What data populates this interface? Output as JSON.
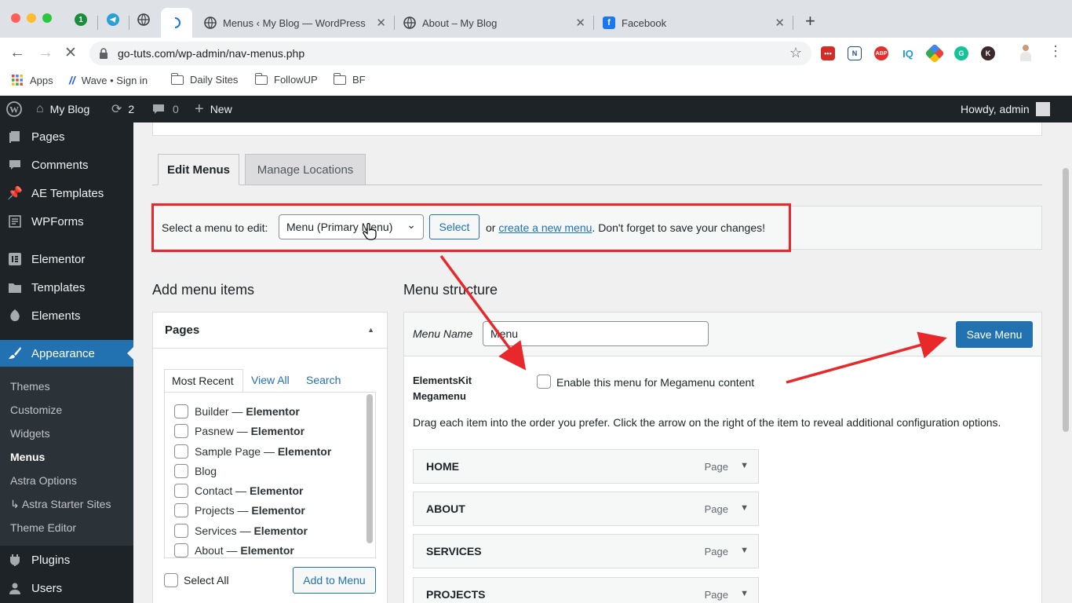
{
  "browser": {
    "pinned_tabs": [
      {
        "icon": "1password-icon",
        "badge": "1"
      },
      {
        "icon": "telegram-icon"
      },
      {
        "icon": "globe-icon"
      }
    ],
    "tabs": [
      {
        "title": "Menus ‹ My Blog — WordPress",
        "icon": "globe-icon"
      },
      {
        "title": "About – My Blog",
        "icon": "globe-icon"
      },
      {
        "title": "Facebook",
        "icon": "facebook-icon",
        "letter": "f"
      }
    ],
    "url": "go-tuts.com/wp-admin/nav-menus.php",
    "extensions": [
      {
        "name": "lastpass-icon",
        "label": "•••",
        "color": "#d32d27"
      },
      {
        "name": "notion-icon",
        "label": "N",
        "color": "#1e4f8f"
      },
      {
        "name": "adblock-icon",
        "label": "ABP",
        "color": "#e62e2e"
      },
      {
        "name": "iq-icon",
        "label": "IQ",
        "color": "#1a9bd7"
      },
      {
        "name": "colorful-icon",
        "label": "",
        "color": "#f4b400"
      },
      {
        "name": "grammarly-icon",
        "label": "G",
        "color": "#15c39a"
      },
      {
        "name": "k-icon",
        "label": "K",
        "color": "#3c2a2a"
      }
    ],
    "bookmarks": [
      {
        "label": "Apps",
        "icon": "apps-grid-icon"
      },
      {
        "label": "Wave • Sign in",
        "icon": "wave-icon"
      },
      {
        "label": "Daily Sites",
        "icon": "folder-icon"
      },
      {
        "label": "FollowUP",
        "icon": "folder-icon"
      },
      {
        "label": "BF",
        "icon": "folder-icon"
      }
    ]
  },
  "adminbar": {
    "site_name": "My Blog",
    "updates_count": "2",
    "comments_count": "0",
    "new_label": "New",
    "greeting": "Howdy, admin"
  },
  "sidebar": {
    "items": [
      {
        "label": "Pages",
        "icon": "pages-icon"
      },
      {
        "label": "Comments",
        "icon": "comments-icon"
      },
      {
        "label": "AE Templates",
        "icon": "pin-icon"
      },
      {
        "label": "WPForms",
        "icon": "wpforms-icon"
      },
      {
        "label": "Elementor",
        "icon": "elementor-icon"
      },
      {
        "label": "Templates",
        "icon": "folder-open-icon"
      },
      {
        "label": "Elements",
        "icon": "elements-icon"
      },
      {
        "label": "Appearance",
        "icon": "brush-icon"
      },
      {
        "label": "Plugins",
        "icon": "plugin-icon"
      },
      {
        "label": "Users",
        "icon": "users-icon"
      }
    ],
    "appearance_submenu": [
      "Themes",
      "Customize",
      "Widgets",
      "Menus",
      "Astra Options",
      "↳ Astra Starter Sites",
      "Theme Editor"
    ]
  },
  "tabs": {
    "edit_menus": "Edit Menus",
    "manage_locations": "Manage Locations"
  },
  "select_bar": {
    "label": "Select a menu to edit:",
    "selected_menu": "Menu (Primary Menu)",
    "select_button": "Select",
    "or_text": "or",
    "create_link": "create a new menu",
    "reminder": ". Don't forget to save your changes!"
  },
  "add_items": {
    "heading": "Add menu items",
    "pages_title": "Pages",
    "subtabs": [
      "Most Recent",
      "View All",
      "Search"
    ],
    "pages": [
      {
        "name": "Builder",
        "suffix": "Elementor"
      },
      {
        "name": "Pasnew",
        "suffix": "Elementor"
      },
      {
        "name": "Sample Page",
        "suffix": "Elementor"
      },
      {
        "name": "Blog",
        "suffix": ""
      },
      {
        "name": "Contact",
        "suffix": "Elementor"
      },
      {
        "name": "Projects",
        "suffix": "Elementor"
      },
      {
        "name": "Services",
        "suffix": "Elementor"
      },
      {
        "name": "About",
        "suffix": "Elementor"
      }
    ],
    "select_all": "Select All",
    "add_button": "Add to Menu"
  },
  "structure": {
    "heading": "Menu structure",
    "menu_name_label": "Menu Name",
    "menu_name_value": "Menu",
    "save_button": "Save Menu",
    "megamenu_label_1": "ElementsKit",
    "megamenu_label_2": "Megamenu",
    "megamenu_checkbox": "Enable this menu for Megamenu content",
    "instructions": "Drag each item into the order you prefer. Click the arrow on the right of the item to reveal additional configuration options.",
    "items": [
      {
        "title": "HOME",
        "type": "Page"
      },
      {
        "title": "ABOUT",
        "type": "Page"
      },
      {
        "title": "SERVICES",
        "type": "Page"
      },
      {
        "title": "PROJECTS",
        "type": "Page"
      }
    ]
  },
  "colors": {
    "wp_blue": "#2271b1",
    "admin_dark": "#1d2327",
    "annotation_red": "#e8282b"
  }
}
